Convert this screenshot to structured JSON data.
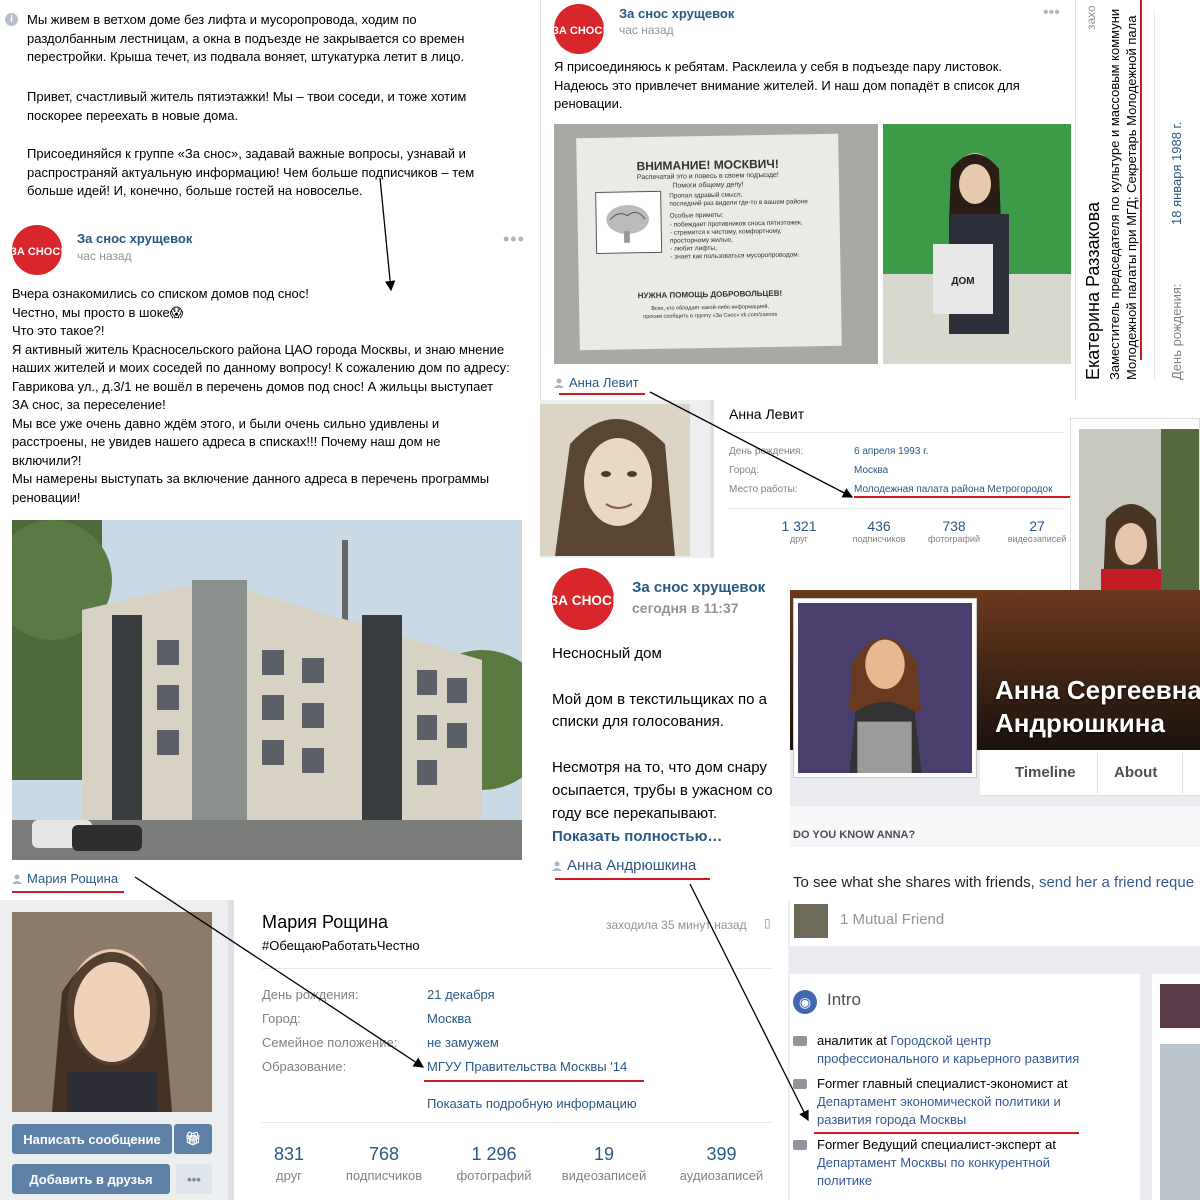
{
  "colors": {
    "vk_link": "#2a5885",
    "red_underline": "#cc1b22",
    "vk_button": "#5e81a8",
    "fb_link": "#365899",
    "brand_red": "#d8262b"
  },
  "group": {
    "name": "За снос хрущевок",
    "avatar_text": "ЗА СНОС!"
  },
  "post_intro": {
    "para1": "Мы живем в ветхом доме без лифта и мусоропровода, ходим по раздолбанным лестницам, а окна в подъезде не закрывается со времен перестройки. Крыша течет, из подвала воняет, штукатурка летит в лицо.",
    "para2": "Привет, счастливый житель пятиэтажки! Мы – твои соседи, и тоже хотим поскорее переехать в новые дома.",
    "para3": "Присоединяйся к группе «За снос», задавай важные вопросы, узнавай и распространяй актуальную информацию! Чем больше подписчиков – тем больше идей! И, конечно, больше гостей на новоселье."
  },
  "post1": {
    "time": "час назад",
    "lines": [
      "Вчера ознакомились со списком домов под снос!",
      "Честно, мы просто в шоке😱",
      "Что это такое?!",
      "Я активный житель Красносельского района ЦАО города Москвы, и знаю мнение наших жителей и моих соседей по данному вопросу! К сожалению дом по адресу: Гаврикова ул., д.3/1 не вошёл в перечень домов под снос! А жильцы выступает ЗА снос, за переселение!",
      "Мы все уже очень давно ждём этого, и были очень сильно удивлены и расстроены, не увидев нашего адреса в списках!!! Почему наш дом не включили?!",
      "Мы намерены выступать за включение данного адреса в перечень программы реновации!"
    ],
    "author": "Мария Рощина"
  },
  "post2": {
    "time": "час назад",
    "text": "Я присоединяюсь к ребятам. Расклеила у себя в подъезде пару листовок. Надеюсь это привлечет внимание жителей. И наш дом попадёт в список для реновации.",
    "author": "Анна Левит",
    "leaflet": {
      "title": "ВНИМАНИЕ! МОСКВИЧ!",
      "sub1": "Распечатай это и повесь в своем подъезде!",
      "sub2": "Помоги общему делу!",
      "lost1": "Пропал здравый смысл,",
      "lost2": "последний раз видели где-то в вашем районе",
      "signs": "Особые приметы:",
      "s1": "- побеждает противников сноса пятиэтажек,",
      "s2": "- стремится к чистому, комфортному,",
      "s3": "  просторному жилью,",
      "s4": "- любит лифты,",
      "s5": "- знает как пользоваться мусоропроводом.",
      "help": "НУЖНА ПОМОЩЬ ДОБРОВОЛЬЦЕВ!",
      "f1": "Всех, кто обладает какой-либо информацией,",
      "f2": "просим сообщить в группу «За Снос» vk.com/zasnos"
    },
    "held_sign": "ДОМ"
  },
  "post3": {
    "time": "сегодня в 11:37",
    "title": "Несносный дом",
    "p1a": "Мой дом в текстильщиках по а",
    "p1b": "списки для голосования.",
    "p2a": "Несмотря на то, что дом снару",
    "p2b": "осыпается, трубы в ужасном со",
    "p2c": "году все перекапывают.",
    "more": "Показать полностью…",
    "author": "Анна Андрюшкина"
  },
  "levit_profile": {
    "name": "Анна Левит",
    "rows": [
      {
        "label": "День рождения:",
        "value": "6 апреля 1993 г."
      },
      {
        "label": "Город:",
        "value": "Москва"
      },
      {
        "label": "Место работы:",
        "value": "Молодежная палата района Метрогородок"
      }
    ],
    "stats": [
      {
        "num": "1 321",
        "lbl": "друг"
      },
      {
        "num": "436",
        "lbl": "подписчиков"
      },
      {
        "num": "738",
        "lbl": "фотографий"
      },
      {
        "num": "27",
        "lbl": "видеозаписей"
      }
    ]
  },
  "roshchina_profile": {
    "name": "Мария Рощина",
    "status": "#ОбещаюРаботатьЧестно",
    "last_seen": "заходила 35 минут назад",
    "rows": [
      {
        "label": "День рождения:",
        "value": "21 декабря"
      },
      {
        "label": "Город:",
        "value": "Москва"
      },
      {
        "label": "Семейное положение:",
        "value": "не замужем"
      },
      {
        "label": "Образование:",
        "value": "МГУУ Правительства Москвы '14"
      }
    ],
    "more": "Показать подробную информацию",
    "stats": [
      {
        "num": "831",
        "lbl": "друг"
      },
      {
        "num": "768",
        "lbl": "подписчиков"
      },
      {
        "num": "1 296",
        "lbl": "фотографий"
      },
      {
        "num": "19",
        "lbl": "видеозаписей"
      },
      {
        "num": "399",
        "lbl": "аудиозаписей"
      }
    ],
    "btn_message": "Написать сообщение",
    "btn_friend": "Добавить в друзья"
  },
  "razzakova": {
    "name": "Екатерина Раззакова",
    "line1": "Заместитель председателя по культуре и массовым коммуни",
    "line2": "Молодежной палаты при МГД; Секретарь Молодежной пала",
    "bday_label": "День рождения:",
    "bday_value": "18 января 1988 г.",
    "corner": "захо"
  },
  "fb": {
    "name1": "Анна Сергеевна",
    "name2": "Андрюшкина",
    "tab_timeline": "Timeline",
    "tab_about": "About",
    "know": "DO YOU KNOW ANNA?",
    "share_a": "To see what she shares with friends, ",
    "share_link": "send her a friend reque",
    "mutual": "1 Mutual Friend",
    "intro": "Intro",
    "jobs": [
      {
        "pre": "аналитик at ",
        "org1": "Городской центр",
        "org2": "профессионального и карьерного развития"
      },
      {
        "pre": "Former главный специалист-экономист at",
        "org1": "Департамент экономической политики и",
        "org2": "развития города Москвы"
      },
      {
        "pre": "Former Ведущий специалист-эксперт at",
        "org1": "Департамент Москвы по конкурентной",
        "org2": "политике"
      }
    ]
  },
  "icons": [
    "info-icon",
    "more-dots-icon",
    "person-icon",
    "gift-icon",
    "briefcase-icon",
    "globe-icon",
    "phone-icon"
  ]
}
